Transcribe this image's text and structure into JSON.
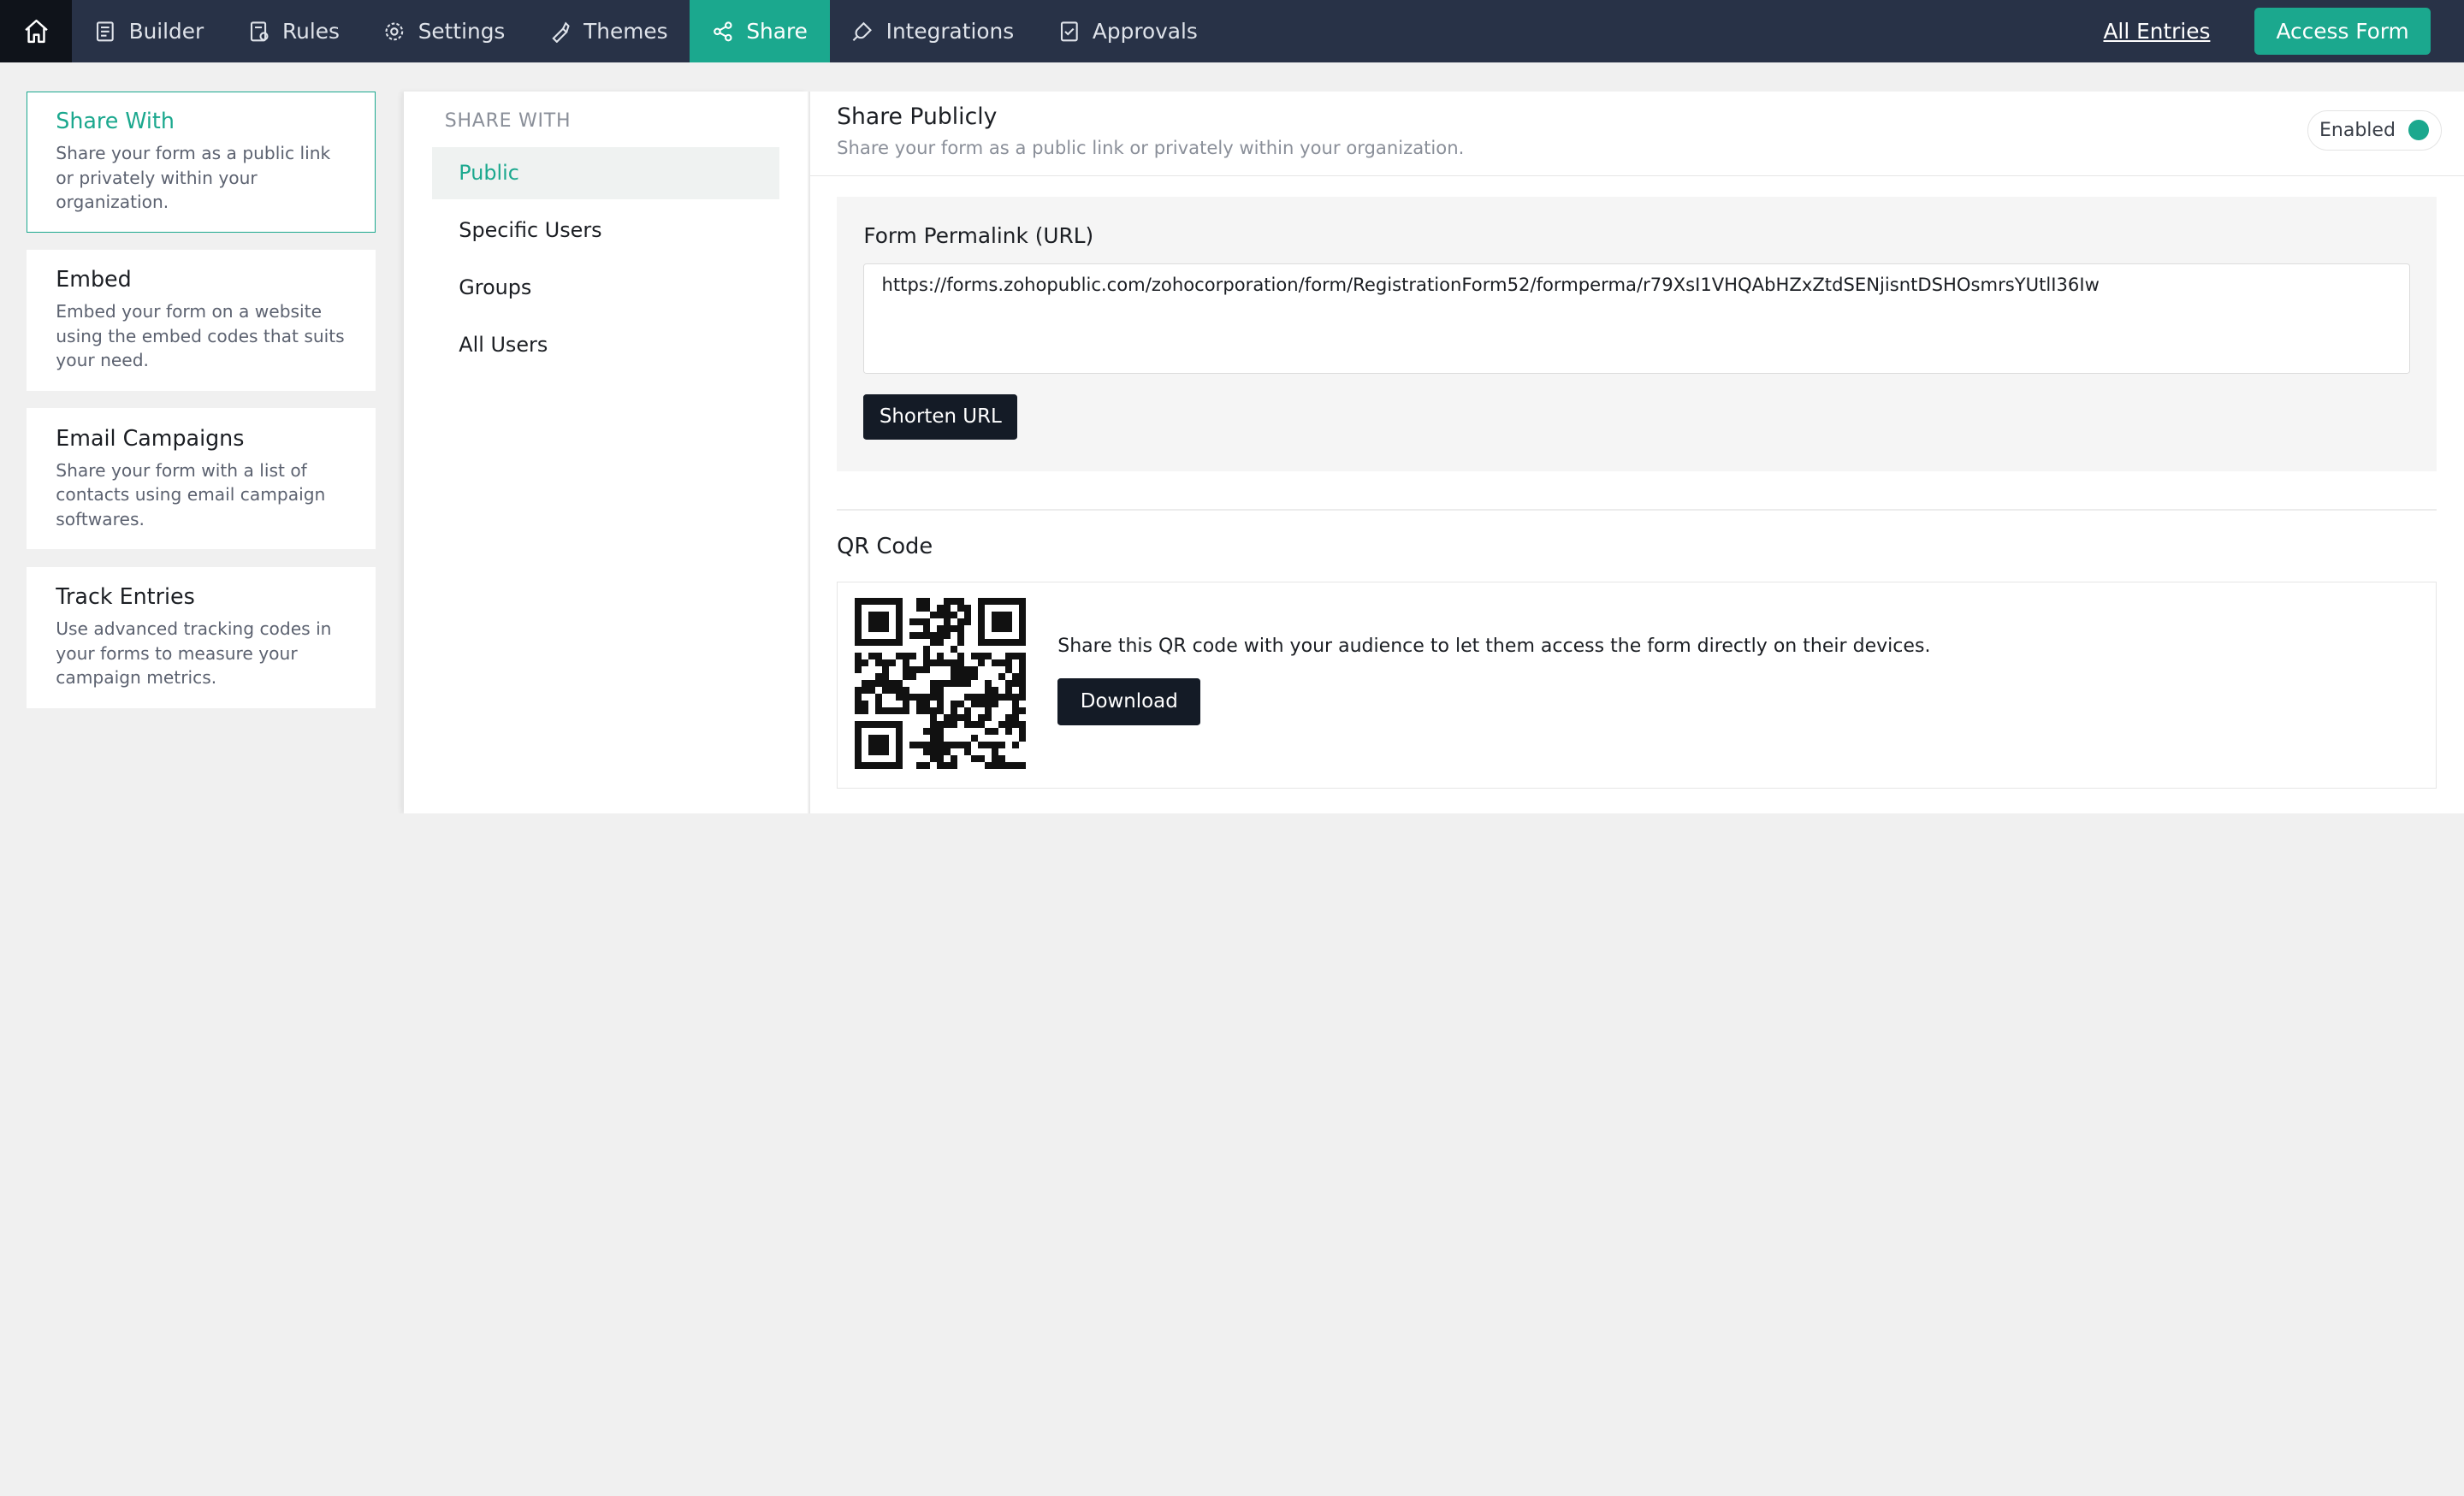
{
  "nav": {
    "items": [
      {
        "label": "Builder",
        "icon": "builder-icon"
      },
      {
        "label": "Rules",
        "icon": "rules-icon"
      },
      {
        "label": "Settings",
        "icon": "gear-icon"
      },
      {
        "label": "Themes",
        "icon": "brush-icon"
      },
      {
        "label": "Share",
        "icon": "share-icon",
        "active": true
      },
      {
        "label": "Integrations",
        "icon": "plug-icon"
      },
      {
        "label": "Approvals",
        "icon": "approvals-icon"
      }
    ],
    "all_entries": "All Entries",
    "access_form": "Access Form"
  },
  "left": {
    "cards": [
      {
        "title": "Share With",
        "desc": "Share your form as a public link or privately within your organization.",
        "active": true
      },
      {
        "title": "Embed",
        "desc": "Embed your form on a website using the embed codes that suits your need."
      },
      {
        "title": "Email Campaigns",
        "desc": "Share your form with a list of contacts using email campaign softwares."
      },
      {
        "title": "Track Entries",
        "desc": "Use advanced tracking codes in your forms to measure your campaign metrics."
      }
    ]
  },
  "middle": {
    "heading": "SHARE WITH",
    "items": [
      "Public",
      "Specific Users",
      "Groups",
      "All Users"
    ]
  },
  "panel": {
    "title": "Share Publicly",
    "subtitle": "Share your form as a public link or privately within your organization.",
    "toggle_label": "Enabled",
    "permalink_label": "Form Permalink (URL)",
    "permalink_url": "https://forms.zohopublic.com/zohocorporation/form/RegistrationForm52/formperma/r79XsI1VHQAbHZxZtdSENjisntDSHOsmrsYUtlI36Iw",
    "shorten_label": "Shorten URL",
    "qr_title": "QR Code",
    "qr_text": "Share this QR code with your audience to let them access the form directly on their devices.",
    "download_label": "Download"
  },
  "colors": {
    "accent": "#1ba88e",
    "topbar": "#283247",
    "dark_button": "#141b26"
  }
}
